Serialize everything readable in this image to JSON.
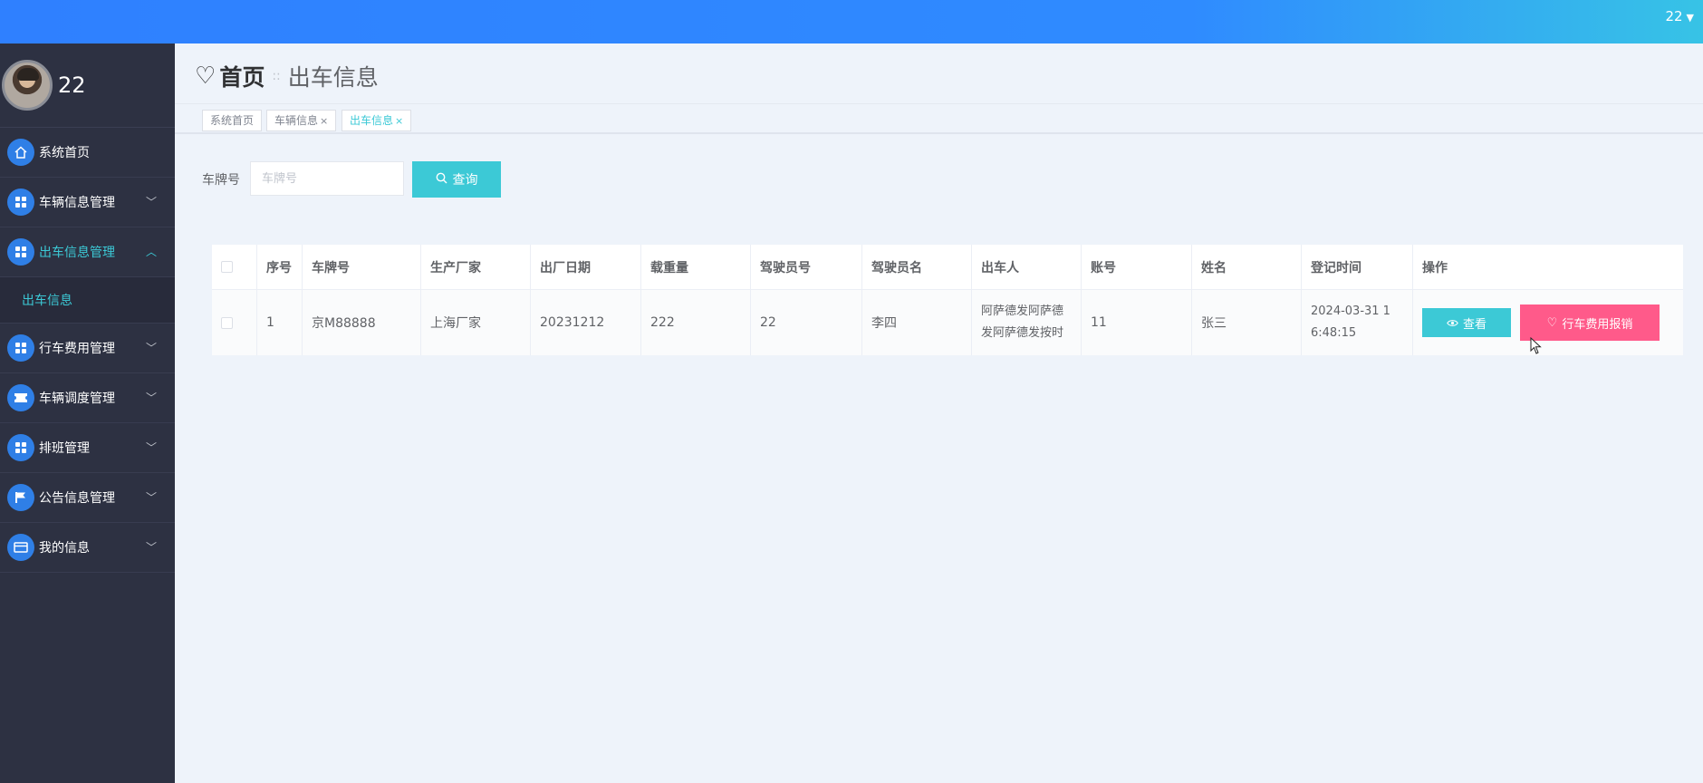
{
  "topbar": {
    "user": "22"
  },
  "sidebar": {
    "username": "22",
    "items": [
      {
        "label": "系统首页",
        "icon": "home-icon"
      },
      {
        "label": "车辆信息管理",
        "icon": "grid-icon"
      },
      {
        "label": "出车信息管理",
        "icon": "grid-icon",
        "active": true,
        "sub": [
          "出车信息"
        ]
      },
      {
        "label": "行车费用管理",
        "icon": "grid-icon"
      },
      {
        "label": "车辆调度管理",
        "icon": "ticket-icon"
      },
      {
        "label": "排班管理",
        "icon": "grid-icon"
      },
      {
        "label": "公告信息管理",
        "icon": "flag-icon"
      },
      {
        "label": "我的信息",
        "icon": "card-icon"
      }
    ]
  },
  "breadcrumb": {
    "home": "首页",
    "current": "出车信息"
  },
  "tags": [
    {
      "label": "系统首页"
    },
    {
      "label": "车辆信息",
      "close": "×"
    },
    {
      "label": "出车信息",
      "close": "×",
      "active": true
    }
  ],
  "search": {
    "label": "车牌号",
    "placeholder": "车牌号",
    "button": "查询"
  },
  "table": {
    "columns": [
      "序号",
      "车牌号",
      "生产厂家",
      "出厂日期",
      "载重量",
      "驾驶员号",
      "驾驶员名",
      "出车人",
      "账号",
      "姓名",
      "登记时间",
      "操作"
    ],
    "rows": [
      {
        "index": "1",
        "plate": "京M88888",
        "maker": "上海厂家",
        "date": "20231212",
        "load": "222",
        "driver_no": "22",
        "driver_name": "李四",
        "dispatcher_line1": "阿萨德发阿萨德",
        "dispatcher_line2": "发阿萨德发按时",
        "account": "11",
        "name": "张三",
        "reg_time_line1": "2024-03-31 1",
        "reg_time_line2": "6:48:15",
        "view_label": "查看",
        "expense_label": "行车费用报销"
      }
    ]
  },
  "colors": {
    "accent": "#3cc9d6",
    "danger": "#ff5a8a",
    "sidebar": "#2d3142",
    "topbar": "#2f80ff"
  }
}
